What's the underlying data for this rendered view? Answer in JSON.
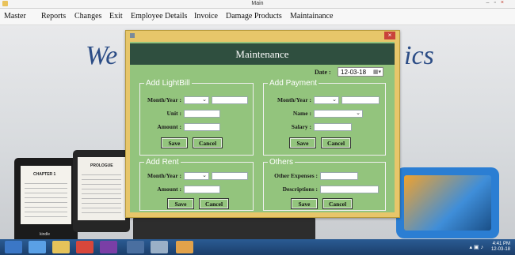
{
  "window": {
    "title": "Main"
  },
  "menu": [
    "Master",
    "Reports",
    "Changes",
    "Exit",
    "Employee Details",
    "Invoice",
    "Damage Products",
    "Maintainance"
  ],
  "background": {
    "welcome_left": "We",
    "welcome_right": "ics"
  },
  "kindle": {
    "chapter": "CHAPTER 1",
    "prologue": "PROLOGUE",
    "brand": "kindle"
  },
  "taskbar": {
    "time": "4:41 PM",
    "date": "12-03-18"
  },
  "dialog": {
    "title": "Maintenance",
    "close_label": "×",
    "date_label": "Date :",
    "date_value": "12-03-18",
    "lightbill": {
      "legend": "Add LightBill",
      "month_label": "Month/Year :",
      "unit_label": "Unit :",
      "amount_label": "Amount :",
      "save": "Save",
      "cancel": "Cancel"
    },
    "payment": {
      "legend": "Add Payment",
      "month_label": "Month/Year :",
      "name_label": "Name :",
      "salary_label": "Salary :",
      "save": "Save",
      "cancel": "Cancel"
    },
    "rent": {
      "legend": "Add Rent",
      "month_label": "Month/Year :",
      "amount_label": "Amount :",
      "save": "Save",
      "cancel": "Cancel"
    },
    "others": {
      "legend": "Others",
      "expenses_label": "Other Expenses :",
      "descriptions_label": "Descriptions :",
      "save": "Save",
      "cancel": "Cancel"
    }
  }
}
